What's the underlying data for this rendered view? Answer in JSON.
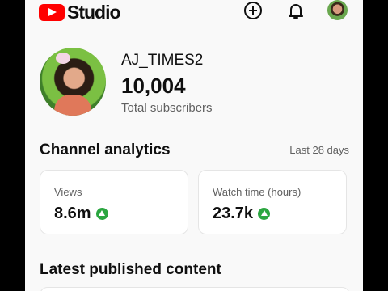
{
  "header": {
    "logo_text": "Studio",
    "brand_color": "#ff0000",
    "icons": [
      "create-icon",
      "notifications-icon",
      "account-avatar"
    ]
  },
  "profile": {
    "channel_name": "AJ_TIMES2",
    "subscriber_count": "10,004",
    "subscriber_label": "Total subscribers"
  },
  "analytics": {
    "title": "Channel analytics",
    "period": "Last 28 days",
    "cards": [
      {
        "label": "Views",
        "value": "8.6m",
        "trend": "up"
      },
      {
        "label": "Watch time (hours)",
        "value": "23.7k",
        "trend": "up"
      }
    ],
    "trend_color": "#2ba640"
  },
  "latest": {
    "title": "Latest published content"
  }
}
